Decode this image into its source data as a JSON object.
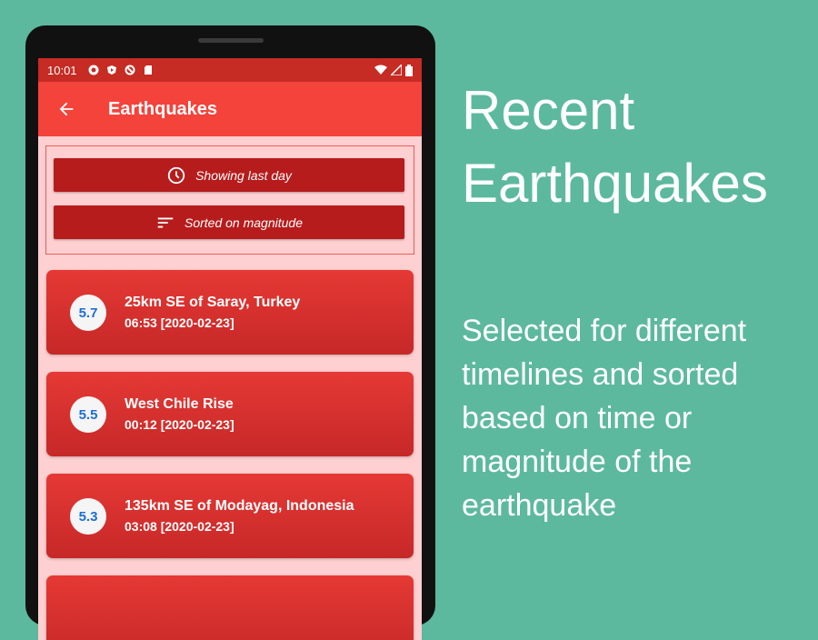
{
  "status_bar": {
    "time": "10:01"
  },
  "app_bar": {
    "title": "Earthquakes"
  },
  "filters": {
    "time_label": "Showing last day",
    "sort_label": "Sorted on magnitude"
  },
  "quakes": [
    {
      "magnitude": "5.7",
      "place": "25km SE of Saray, Turkey",
      "time": "06:53 [2020-02-23]"
    },
    {
      "magnitude": "5.5",
      "place": "West Chile Rise",
      "time": "00:12 [2020-02-23]"
    },
    {
      "magnitude": "5.3",
      "place": "135km SE of Modayag, Indonesia",
      "time": "03:08 [2020-02-23]"
    }
  ],
  "caption": {
    "title": "Recent Earthquakes",
    "description": "Selected for different timelines and sorted based on time or magnitude of the earthquake"
  },
  "colors": {
    "background": "#5db99d",
    "app_bar": "#f4433b",
    "status_bar": "#c62b24",
    "button": "#b71c1c",
    "card": "#e53935",
    "magnitude_text": "#1e6fd1"
  }
}
